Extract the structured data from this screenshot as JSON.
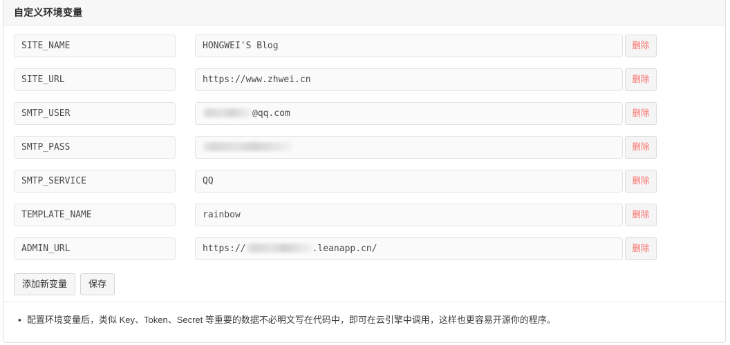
{
  "panel": {
    "title": "自定义环境变量"
  },
  "table": {
    "rows": [
      {
        "key": "SITE_NAME",
        "value": "HONGWEI'S Blog",
        "value_prefix": "",
        "value_suffix": "",
        "redacted": false,
        "delete_label": "删除"
      },
      {
        "key": "SITE_URL",
        "value": "https://www.zhwei.cn",
        "value_prefix": "",
        "value_suffix": "",
        "redacted": false,
        "delete_label": "删除"
      },
      {
        "key": "SMTP_USER",
        "value": "",
        "value_prefix": "",
        "value_suffix": "@qq.com",
        "redacted": true,
        "delete_label": "删除"
      },
      {
        "key": "SMTP_PASS",
        "value": "",
        "value_prefix": "",
        "value_suffix": "",
        "redacted": true,
        "delete_label": "删除"
      },
      {
        "key": "SMTP_SERVICE",
        "value": "QQ",
        "value_prefix": "",
        "value_suffix": "",
        "redacted": false,
        "delete_label": "删除"
      },
      {
        "key": "TEMPLATE_NAME",
        "value": "rainbow",
        "value_prefix": "",
        "value_suffix": "",
        "redacted": false,
        "delete_label": "删除"
      },
      {
        "key": "ADMIN_URL",
        "value": "",
        "value_prefix": "https://",
        "value_suffix": ".leanapp.cn/",
        "redacted": true,
        "delete_label": "删除"
      }
    ]
  },
  "actions": {
    "add_label": "添加新变量",
    "save_label": "保存"
  },
  "footer": {
    "bullet_glyph": "▪",
    "note": "配置环境变量后，类似 Key、Token、Secret 等重要的数据不必明文写在代码中，即可在云引擎中调用，这样也更容易开源你的程序。"
  },
  "colors": {
    "delete_text": "#f9736c",
    "panel_header_bg": "#f7f7f7",
    "input_bg": "#fafafa",
    "border": "#e3e3e3"
  }
}
